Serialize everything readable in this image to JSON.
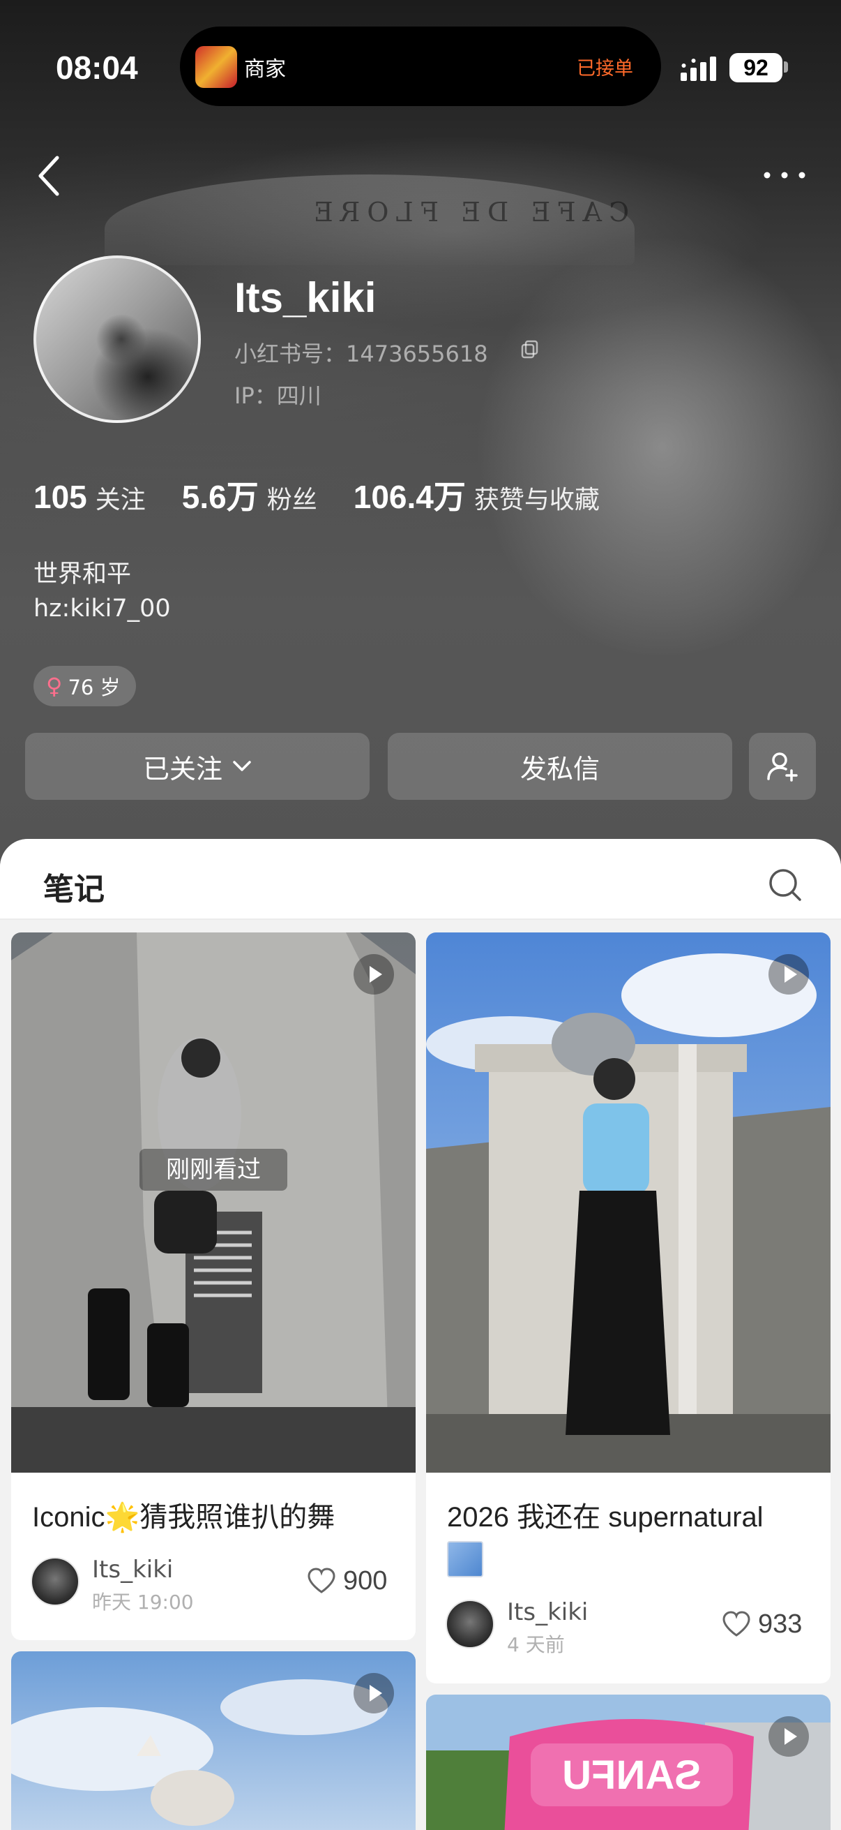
{
  "status_bar": {
    "time": "08:04",
    "live_activity": {
      "app_name": "商家",
      "status": "已接单"
    },
    "battery": "92"
  },
  "profile": {
    "username": "Its_kiki",
    "xhs_id": "小红书号：1473655618",
    "ip": "IP：四川",
    "stats": [
      {
        "value": "105",
        "label": "关注"
      },
      {
        "value": "5.6万",
        "label": "粉丝"
      },
      {
        "value": "106.4万",
        "label": "获赞与收藏"
      }
    ],
    "bio_line1": "世界和平",
    "bio_line2": "hz:kiki7_00",
    "age_tag": "76 岁"
  },
  "actions": {
    "follow_label": "已关注",
    "message_label": "发私信"
  },
  "tabs": {
    "notes_label": "笔记"
  },
  "notes": [
    {
      "title": "Iconic🌟猜我照谁扒的舞",
      "author": "Its_kiki",
      "time": "昨天 19:00",
      "likes": "900",
      "badge": "刚刚看过"
    },
    {
      "title": "2026 我还在 supernatural",
      "author": "Its_kiki",
      "time": "4 天前",
      "likes": "933"
    }
  ],
  "colors": {
    "accent_orange": "#ff6a2a",
    "female_pink": "#ff6f8d"
  }
}
